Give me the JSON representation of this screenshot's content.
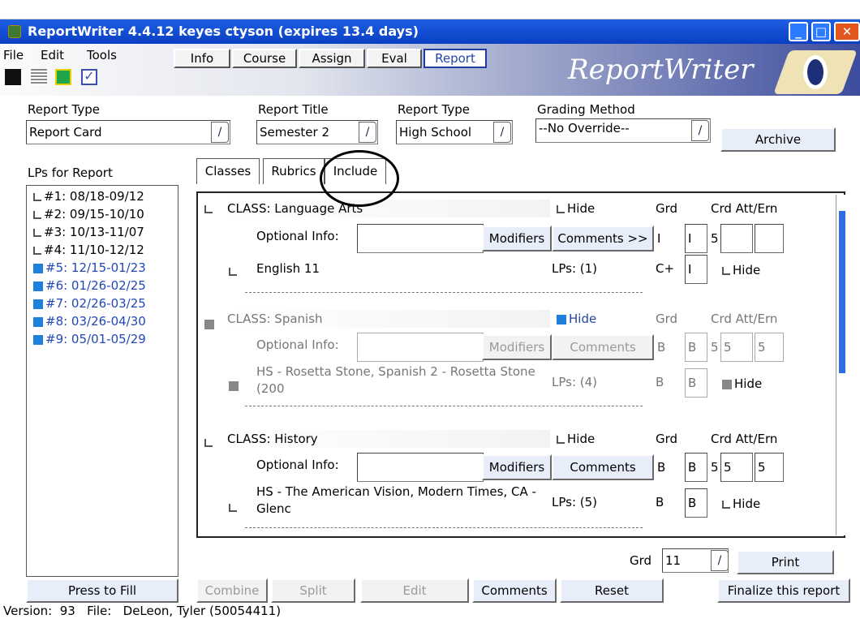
{
  "window": {
    "title": "ReportWriter 4.4.12  keyes ctyson (expires 13.4 days)",
    "brand": "ReportWriter"
  },
  "menu": [
    "File",
    "Edit",
    "Tools"
  ],
  "mode_tabs": [
    {
      "label": "Info"
    },
    {
      "label": "Course"
    },
    {
      "label": "Assign"
    },
    {
      "label": "Eval"
    },
    {
      "label": "Report",
      "active": true
    }
  ],
  "toolbar_icons": [
    "save-icon",
    "list-icon",
    "flag-icon",
    "check-icon"
  ],
  "header": {
    "report_type_label": "Report Type",
    "report_type_value": "Report Card",
    "report_title_label": "Report Title",
    "report_title_value": "Semester 2",
    "report_type2_label": "Report Type",
    "report_type2_value": "High School",
    "grading_label": "Grading Method",
    "grading_value": "--No Override--",
    "archive": "Archive"
  },
  "lps": {
    "label": "LPs for Report",
    "items": [
      {
        "text": "#1: 08/18-09/12",
        "checked": false
      },
      {
        "text": "#2: 09/15-10/10",
        "checked": false
      },
      {
        "text": "#3: 10/13-11/07",
        "checked": false
      },
      {
        "text": "#4: 11/10-12/12",
        "checked": false
      },
      {
        "text": "#5: 12/15-01/23",
        "checked": true
      },
      {
        "text": "#6: 01/26-02/25",
        "checked": true
      },
      {
        "text": "#7: 02/26-03/25",
        "checked": true
      },
      {
        "text": "#8: 03/26-04/30",
        "checked": true
      },
      {
        "text": "#9: 05/01-05/29",
        "checked": true
      }
    ]
  },
  "subtabs": [
    "Classes",
    "Rubrics",
    "Include"
  ],
  "cols": {
    "hide": "Hide",
    "grd": "Grd",
    "crd": "Crd Att/Ern",
    "optional": "Optional Info:",
    "modifiers": "Modifiers",
    "lps_prefix": "LPs:"
  },
  "classes": [
    {
      "name": "CLASS: Language Arts",
      "comments": "Comments >>",
      "grd": "I",
      "g2": "I",
      "att": "5",
      "ern": "",
      "course": "English 11",
      "lps": "LPs: (1)",
      "cgrade": "C+",
      "cbox": "I",
      "hidden": false
    },
    {
      "name": "CLASS: Spanish",
      "comments": "Comments",
      "grd": "B",
      "g2": "B",
      "att": "5",
      "ern": "5",
      "ern2": "5",
      "course": "HS - Rosetta Stone, Spanish 2 - Rosetta Stone (200",
      "lps": "LPs: (4)",
      "cgrade": "B",
      "cbox": "B",
      "hidden": true
    },
    {
      "name": "CLASS: History",
      "comments": "Comments",
      "grd": "B",
      "g2": "B",
      "att": "5",
      "ern": "5",
      "ern2": "5",
      "course": "HS - The American Vision, Modern Times, CA - Glenc",
      "lps": "LPs: (5)",
      "cgrade": "B",
      "cbox": "B",
      "hidden": false
    }
  ],
  "footer": {
    "grd_label": "Grd",
    "grd_value": "11",
    "print": "Print",
    "press": "Press to Fill",
    "combine": "Combine",
    "split": "Split",
    "edit": "Edit",
    "comments": "Comments",
    "reset": "Reset",
    "finalize": "Finalize this report"
  },
  "status": {
    "version_label": "Version:",
    "version": "93",
    "file_label": "File:",
    "file": "DeLeon, Tyler (50054411)"
  }
}
